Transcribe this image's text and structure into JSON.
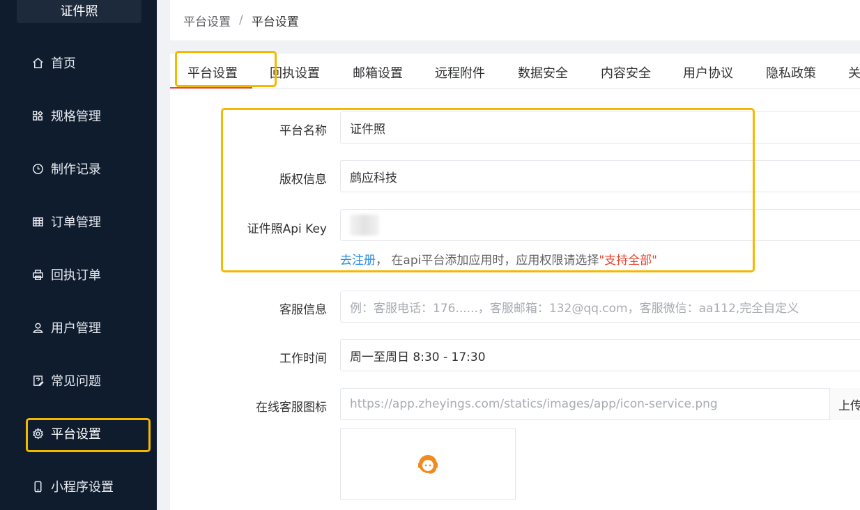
{
  "sidebar": {
    "logo": "证件照",
    "items": [
      {
        "label": "首页",
        "icon": "home-icon"
      },
      {
        "label": "规格管理",
        "icon": "grid-icon"
      },
      {
        "label": "制作记录",
        "icon": "clock-icon"
      },
      {
        "label": "订单管理",
        "icon": "table-icon"
      },
      {
        "label": "回执订单",
        "icon": "printer-icon"
      },
      {
        "label": "用户管理",
        "icon": "user-icon"
      },
      {
        "label": "常见问题",
        "icon": "question-edit-icon"
      },
      {
        "label": "平台设置",
        "icon": "gear-icon"
      },
      {
        "label": "小程序设置",
        "icon": "phone-icon"
      }
    ]
  },
  "breadcrumb": {
    "parent": "平台设置",
    "separator": "/",
    "current": "平台设置"
  },
  "tabs": [
    "平台设置",
    "回执设置",
    "邮箱设置",
    "远程附件",
    "数据安全",
    "内容安全",
    "用户协议",
    "隐私政策",
    "关"
  ],
  "form": {
    "platform_name": {
      "label": "平台名称",
      "value": "证件照"
    },
    "copyright": {
      "label": "版权信息",
      "value": "鹧应科技"
    },
    "api_key": {
      "label": "证件照Api Key",
      "value": ""
    },
    "hint": {
      "link": "去注册",
      "text": "， 在api平台添加应用时，应用权限请选择",
      "emph": "\"支持全部\""
    },
    "service_info": {
      "label": "客服信息",
      "placeholder": "例：客服电话：176......，客服邮箱：132@qq.com，客服微信：aa112,完全自定义"
    },
    "work_time": {
      "label": "工作时间",
      "value": "周一至周日 8:30 - 17:30"
    },
    "service_icon": {
      "label": "在线客服图标",
      "placeholder": "https://app.zheyings.com/statics/images/app/icon-service.png",
      "upload": "上传"
    }
  },
  "colors": {
    "sidebar_bg": "#0f1c2e",
    "highlight": "#f5b800",
    "accent": "#e8462f",
    "link": "#2a8ce6"
  }
}
